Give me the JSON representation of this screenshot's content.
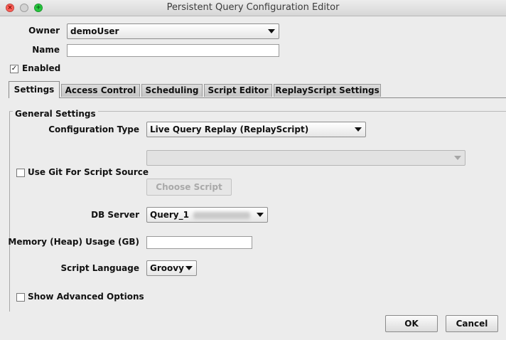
{
  "window": {
    "title": "Persistent Query Configuration Editor"
  },
  "owner": {
    "label": "Owner",
    "value": "demoUser"
  },
  "name": {
    "label": "Name",
    "value": ""
  },
  "enabled": {
    "label": "Enabled",
    "checked": true
  },
  "tabs": [
    {
      "label": "Settings",
      "active": true
    },
    {
      "label": "Access Control"
    },
    {
      "label": "Scheduling"
    },
    {
      "label": "Script Editor"
    },
    {
      "label": "ReplayScript Settings"
    }
  ],
  "general": {
    "heading": "General Settings",
    "config_type_label": "Configuration Type",
    "config_type_value": "Live Query Replay (ReplayScript)",
    "use_git_label": "Use Git For Script Source",
    "choose_script_label": "Choose Script",
    "db_server_label": "DB Server",
    "db_server_value": "Query_1",
    "memory_label": "Memory (Heap) Usage (GB)",
    "memory_value": "",
    "script_language_label": "Script Language",
    "script_language_value": "Groovy",
    "show_advanced_label": "Show Advanced Options"
  },
  "buttons": {
    "ok": "OK",
    "cancel": "Cancel"
  }
}
